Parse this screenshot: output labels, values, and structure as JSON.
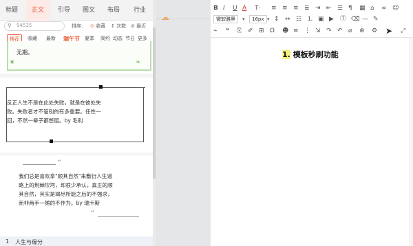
{
  "tabs": [
    {
      "label": "标题"
    },
    {
      "label": "正文"
    },
    {
      "label": "引导"
    },
    {
      "label": "图文"
    },
    {
      "label": "布局"
    },
    {
      "label": "行业"
    }
  ],
  "search": {
    "value": "94535",
    "icon": "search-icon"
  },
  "sort": {
    "label": "排序:",
    "options": [
      "收藏",
      "次数",
      "最近"
    ],
    "active": "收藏"
  },
  "filters": [
    "推荐",
    "收藏",
    "最新",
    "端午节",
    "夏季",
    "简约",
    "动态",
    "节日",
    "更多"
  ],
  "cards": {
    "card1_text": "无期。",
    "card2_lines": [
      "反正人生不是在此处失败，就是在彼处失",
      "败。失败者才不管别的有多重要。任性一",
      "回，不然一辈子都憋屈。by 毛利"
    ],
    "card3_lines": [
      "我们总是喜欢拿\"顺其自然\"来敷衍人生道",
      "路上的荆棘坎坷，却很少承认，真正的顺",
      "其自然，其实是竭尽所能之后的不强求，",
      "而非两手一摊的不作为。by 瑞卡斯"
    ],
    "open_quote": "“",
    "close_quote": "”"
  },
  "section": {
    "number": "1",
    "title": "人生与缘分"
  },
  "editor": {
    "font_family": "微软雅黑",
    "font_size": "16px",
    "doc_title_number": "1.",
    "doc_title_text": "模板秒刷功能"
  },
  "colors": {
    "accent": "#e8603c",
    "card_border": "#b9dcaa",
    "highlight": "#f6f081"
  }
}
